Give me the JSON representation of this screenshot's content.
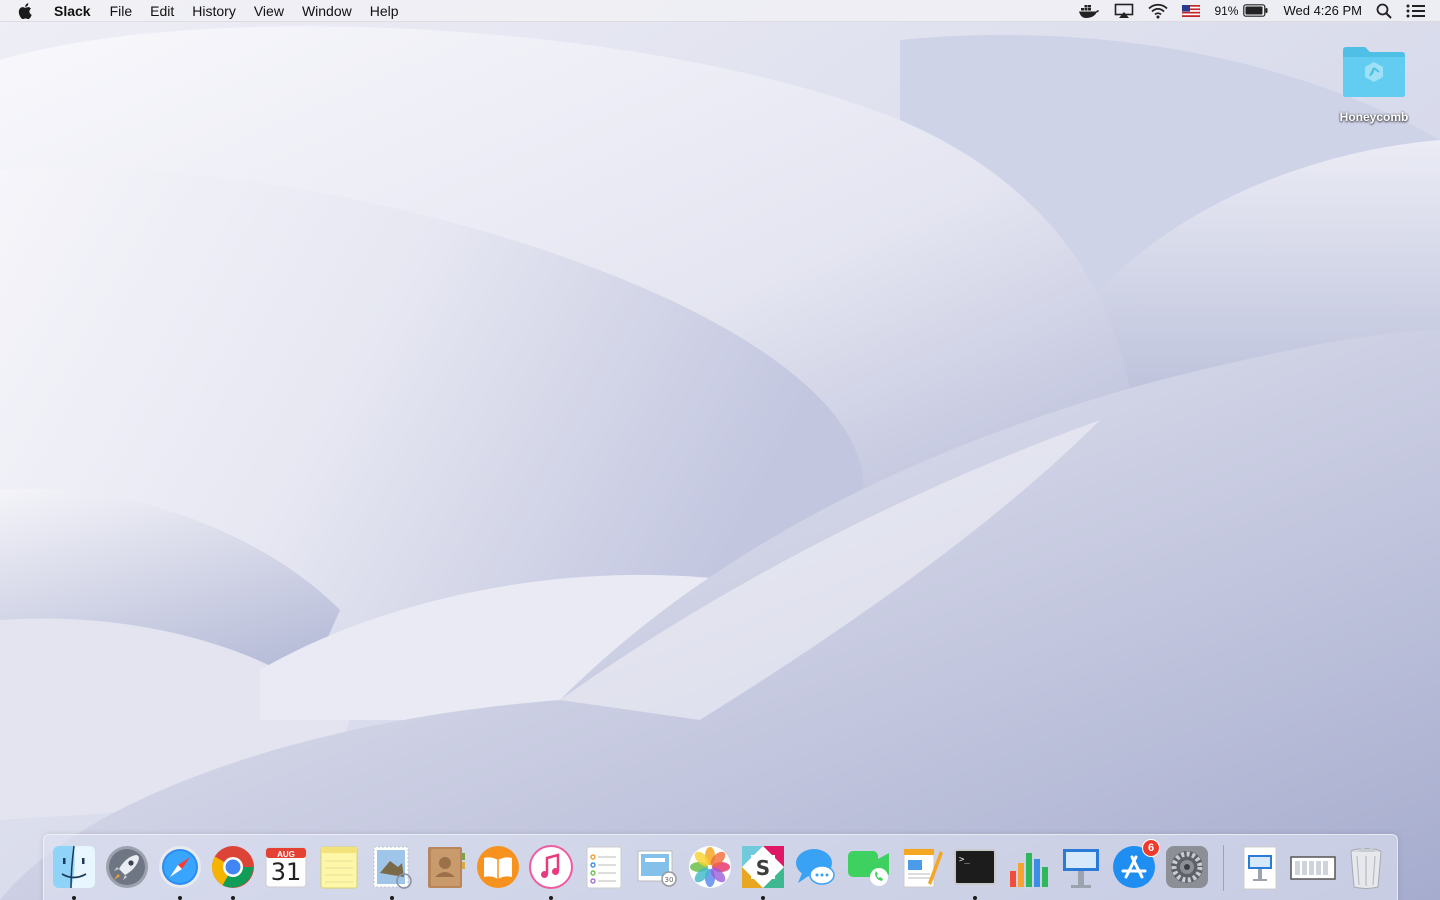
{
  "menubar": {
    "app_name": "Slack",
    "menus": [
      "File",
      "Edit",
      "History",
      "View",
      "Window",
      "Help"
    ],
    "status": {
      "icons": [
        "docker-icon",
        "airplay-icon",
        "wifi-icon",
        "us-flag-icon"
      ],
      "battery_percent": "91%",
      "datetime": "Wed 4:26 PM"
    }
  },
  "desktop": {
    "icons": [
      {
        "label": "Honeycomb",
        "icon": "folder-icon"
      }
    ]
  },
  "dock": {
    "apps": [
      {
        "name": "Finder",
        "running": true
      },
      {
        "name": "Launchpad",
        "running": false
      },
      {
        "name": "Safari",
        "running": true
      },
      {
        "name": "Google Chrome",
        "running": true
      },
      {
        "name": "Calendar",
        "running": false,
        "month": "AUG",
        "day": "31"
      },
      {
        "name": "Notes",
        "running": false
      },
      {
        "name": "Mail",
        "running": true
      },
      {
        "name": "Contacts",
        "running": false
      },
      {
        "name": "iBooks",
        "running": false
      },
      {
        "name": "iTunes",
        "running": true
      },
      {
        "name": "Reminders",
        "running": false
      },
      {
        "name": "Preview",
        "running": false
      },
      {
        "name": "Photos",
        "running": false
      },
      {
        "name": "Slack",
        "running": true
      },
      {
        "name": "Messages",
        "running": false
      },
      {
        "name": "FaceTime",
        "running": false
      },
      {
        "name": "Pages",
        "running": false
      },
      {
        "name": "Terminal",
        "running": true
      },
      {
        "name": "Numbers",
        "running": false
      },
      {
        "name": "Keynote",
        "running": false
      },
      {
        "name": "App Store",
        "running": false,
        "badge": "6"
      },
      {
        "name": "System Preferences",
        "running": false
      },
      {
        "name": "Keynote Document",
        "running": false
      },
      {
        "name": "Downloads",
        "running": false
      },
      {
        "name": "Trash",
        "running": false
      }
    ]
  },
  "colors": {
    "menubar_bg": "#f0f0f4",
    "badge": "#f13a2e",
    "folder": "#5ccbee"
  }
}
